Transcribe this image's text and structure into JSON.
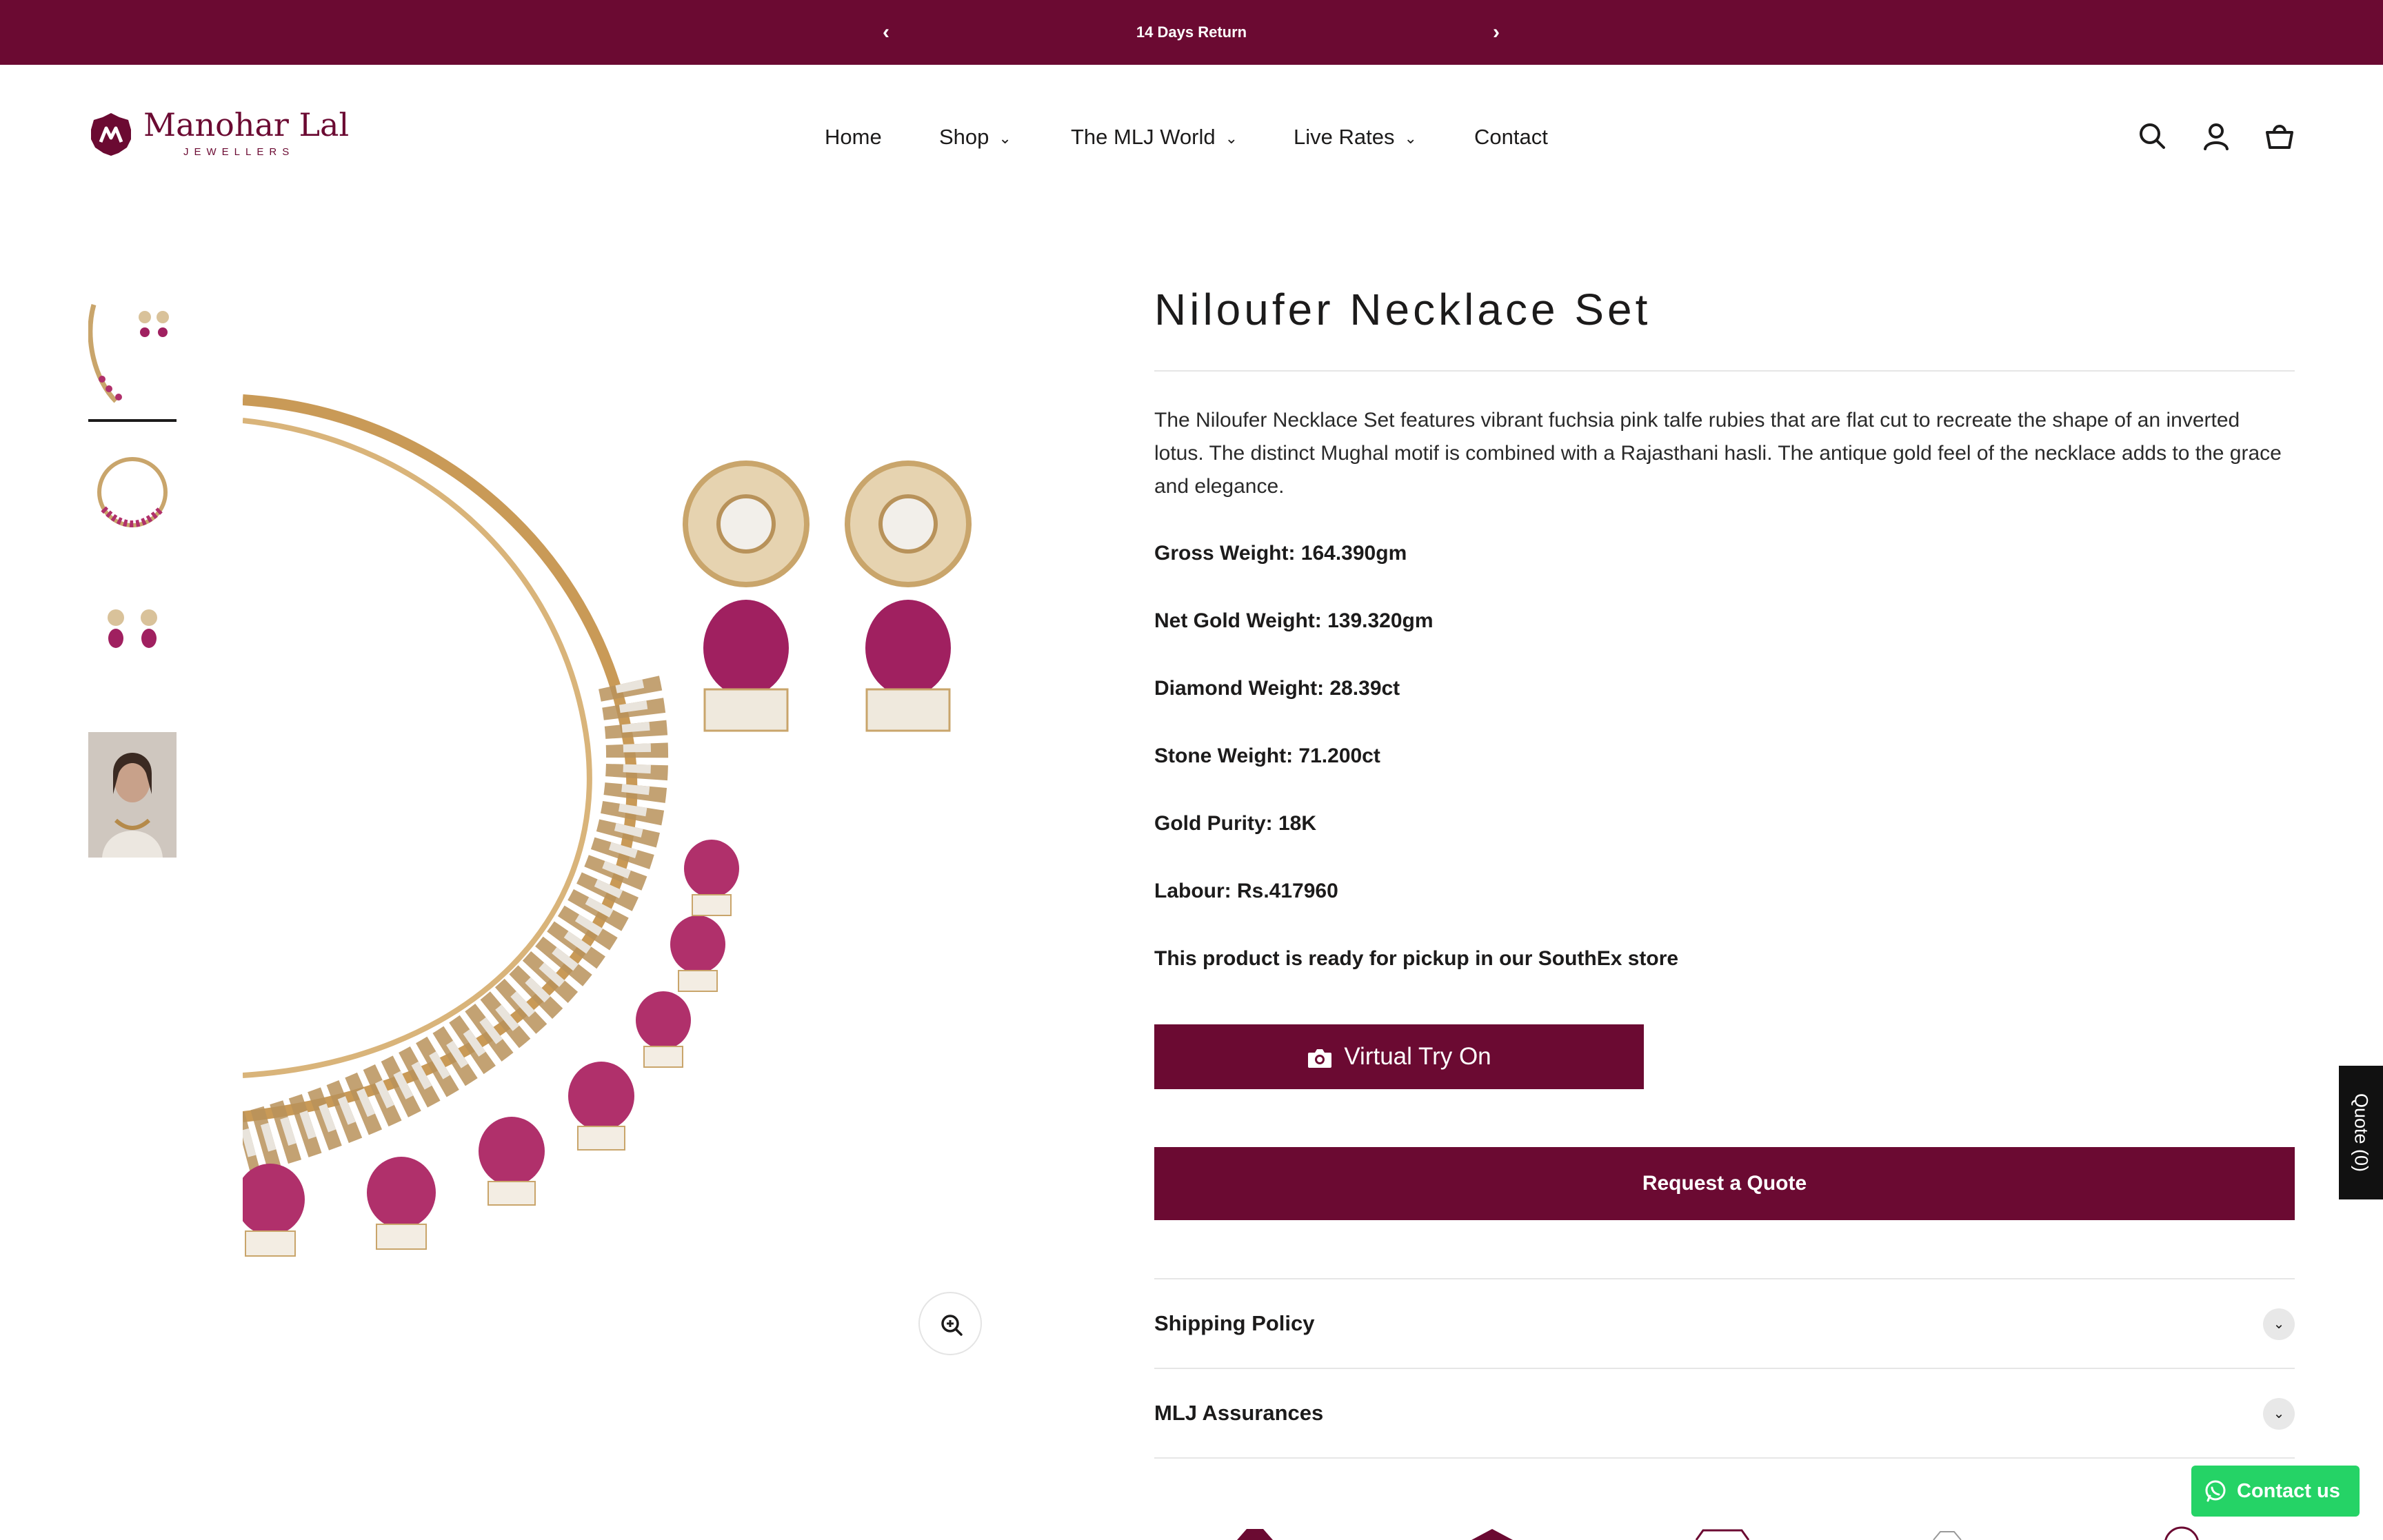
{
  "announcement": {
    "text": "14 Days Return",
    "prev": "‹",
    "next": "›"
  },
  "brand": {
    "name": "Manohar Lal",
    "sub": "JEWELLERS",
    "color": "#6b0a32"
  },
  "nav": {
    "items": [
      {
        "label": "Home",
        "dropdown": false
      },
      {
        "label": "Shop",
        "dropdown": true
      },
      {
        "label": "The MLJ World",
        "dropdown": true
      },
      {
        "label": "Live Rates",
        "dropdown": true
      },
      {
        "label": "Contact",
        "dropdown": false
      }
    ],
    "icons": [
      "search-icon",
      "account-icon",
      "cart-icon"
    ]
  },
  "product": {
    "title": "Niloufer Necklace Set",
    "description": "The Niloufer Necklace Set features vibrant fuchsia pink talfe rubies that are flat cut to recreate the shape of an inverted lotus. The distinct Mughal motif is combined with a Rajasthani hasli. The antique gold feel of the necklace adds to the grace and elegance.",
    "specs": [
      "Gross Weight: 164.390gm",
      "Net Gold Weight: 139.320gm",
      "Diamond Weight: 28.39ct",
      "Stone Weight: 71.200ct",
      "Gold Purity: 18K",
      "Labour: Rs.417960",
      "This product is ready for pickup in our SouthEx store"
    ]
  },
  "buttons": {
    "virtual_try_on": "Virtual Try On",
    "request_quote": "Request a Quote",
    "contact_us": "Contact us",
    "quote_tab": "Quote (0)"
  },
  "accordion": [
    {
      "label": "Shipping Policy"
    },
    {
      "label": "MLJ Assurances"
    }
  ],
  "colors": {
    "accent": "#6b0a32",
    "whatsapp": "#25d366"
  }
}
